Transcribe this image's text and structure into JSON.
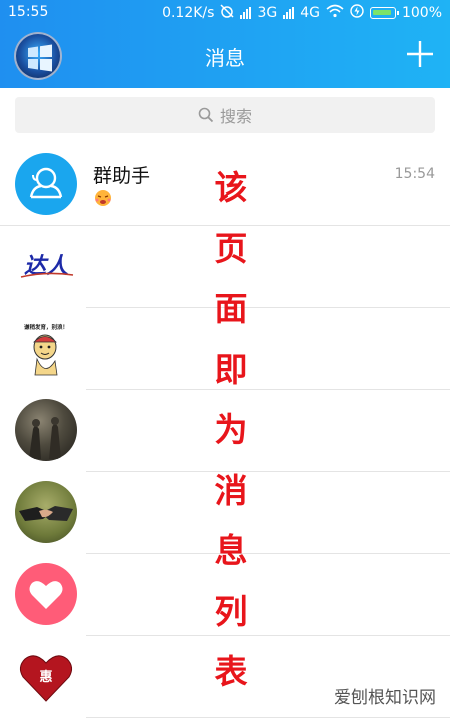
{
  "status_bar": {
    "time": "15:55",
    "speed": "0.12K/s",
    "network_3g": "3G",
    "network_4g": "4G",
    "battery": "100%"
  },
  "header": {
    "title": "消息",
    "accent_color": "#1fa0f3"
  },
  "search": {
    "placeholder": "搜索"
  },
  "conversations": [
    {
      "name": "群助手",
      "time": "15:54",
      "preview_icon": "emoji-icon",
      "avatar": "group-assistant-avatar"
    },
    {
      "name": "",
      "time": "",
      "avatar": "daren-logo-avatar"
    },
    {
      "name": "",
      "time": "",
      "avatar": "meme-avatar"
    },
    {
      "name": "",
      "time": "",
      "avatar": "dark-photo-avatar"
    },
    {
      "name": "",
      "time": "",
      "avatar": "handshake-avatar"
    },
    {
      "name": "",
      "time": "",
      "avatar": "heart-avatar"
    },
    {
      "name": "",
      "time": "",
      "avatar": "red-heart-avatar"
    }
  ],
  "avatar_texts": {
    "daren": "达人",
    "meme": "谦稍发育，别浪！",
    "heart": "惠"
  },
  "overlay_text": [
    "该",
    "页",
    "面",
    "即",
    "为",
    "消",
    "息",
    "列",
    "表"
  ],
  "watermark": "爱刨根知识网"
}
